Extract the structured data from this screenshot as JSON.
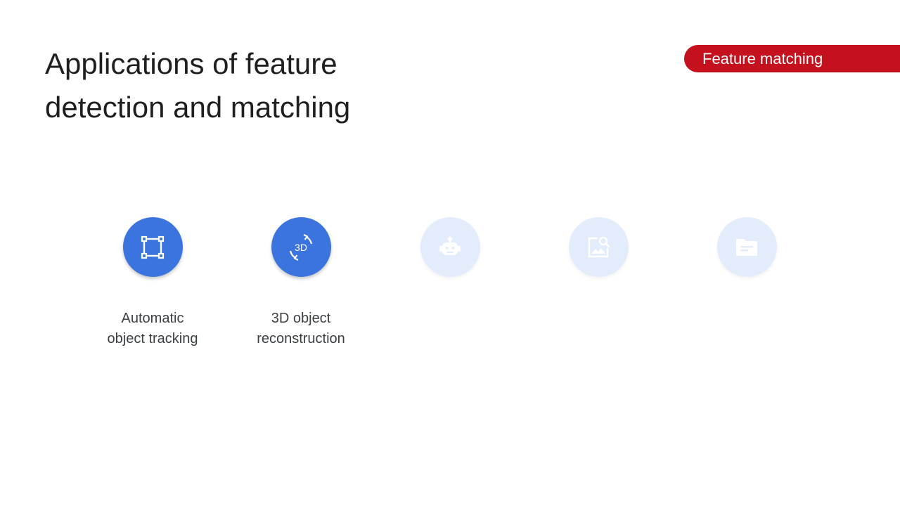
{
  "slide": {
    "title_line1": "Applications of feature",
    "title_line2": "detection and matching",
    "badge": "Feature matching"
  },
  "colors": {
    "accent_red": "#c5101e",
    "active_blue": "#3b74de",
    "inactive_blue": "#e3ecfb"
  },
  "applications": [
    {
      "icon": "bounding-box-icon",
      "state": "active",
      "line1": "Automatic",
      "line2": "object tracking"
    },
    {
      "icon": "3d-rotation-icon",
      "state": "active",
      "line1": "3D object",
      "line2": "reconstruction",
      "icon_text": "3D"
    },
    {
      "icon": "robot-icon",
      "state": "inactive"
    },
    {
      "icon": "image-search-icon",
      "state": "inactive"
    },
    {
      "icon": "folder-icon",
      "state": "inactive"
    }
  ]
}
